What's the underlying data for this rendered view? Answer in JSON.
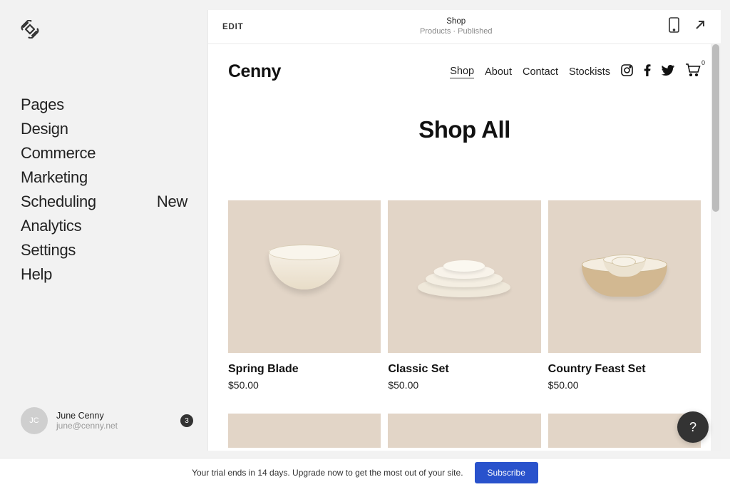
{
  "sidebar": {
    "items": [
      {
        "label": "Pages"
      },
      {
        "label": "Design"
      },
      {
        "label": "Commerce"
      },
      {
        "label": "Marketing"
      },
      {
        "label": "Scheduling",
        "badge": "New"
      },
      {
        "label": "Analytics"
      },
      {
        "label": "Settings"
      },
      {
        "label": "Help"
      }
    ],
    "user": {
      "initials": "JC",
      "name": "June Cenny",
      "email": "june@cenny.net",
      "notifications": 3
    }
  },
  "topbar": {
    "edit": "EDIT",
    "title": "Shop",
    "subtitle": "Products · Published"
  },
  "site": {
    "brand": "Cenny",
    "nav": [
      "Shop",
      "About",
      "Contact",
      "Stockists"
    ],
    "active_nav": "Shop",
    "cart_count": "0",
    "page_title": "Shop All",
    "products": [
      {
        "name": "Spring Blade",
        "price": "$50.00"
      },
      {
        "name": "Classic Set",
        "price": "$50.00"
      },
      {
        "name": "Country Feast Set",
        "price": "$50.00"
      }
    ]
  },
  "banner": {
    "text": "Your trial ends in 14 days. Upgrade now to get the most out of your site.",
    "button": "Subscribe"
  },
  "help_fab": "?"
}
